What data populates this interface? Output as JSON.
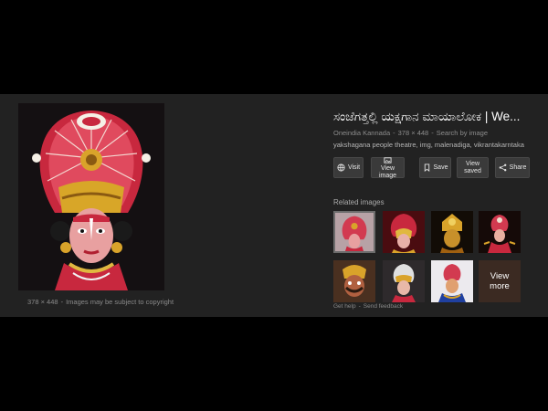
{
  "main_image": {
    "alt": "Yakshagana performer",
    "caption_dims": "378 × 448",
    "caption_sep": "-",
    "caption_text": "Images may be subject to copyright"
  },
  "details": {
    "title": "ಸಂಜೆಗತ್ತಲ್ಲಿ ಯಕ್ಷಗಾನ ಮಾಯಾಲೋಕ | We...",
    "source": "Oneindia Kannada",
    "dims": "378 × 448",
    "search_link": "Search by image",
    "sep": "-",
    "tags": "yakshagana people theatre, img, malenadiga, vikrantakarntaka"
  },
  "actions": {
    "visit": "Visit",
    "view_image_1": "View",
    "view_image_2": "image",
    "save": "Save",
    "view_saved_1": "View",
    "view_saved_2": "saved",
    "share": "Share"
  },
  "related": {
    "label": "Related images",
    "view_more_1": "View",
    "view_more_2": "more"
  },
  "footer": {
    "help": "Get help",
    "sep": "-",
    "feedback": "Send feedback"
  },
  "colors": {
    "panel_bg": "#222222",
    "page_bg": "#000000",
    "button_bg": "#3a3a3a"
  }
}
